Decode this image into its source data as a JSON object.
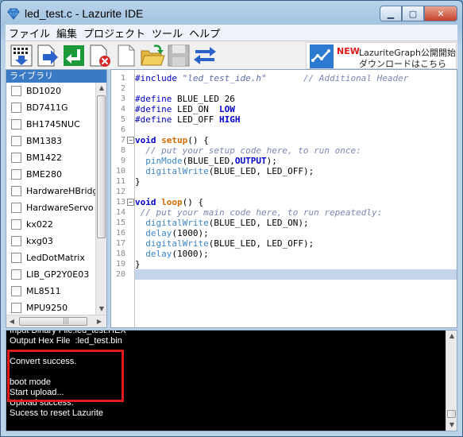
{
  "window": {
    "title": "led_test.c - Lazurite IDE"
  },
  "menu": [
    "ファイル",
    "編集",
    "プロジェクト",
    "ツール",
    "ヘルプ"
  ],
  "toolbar": {
    "buttons": [
      "compile-icon",
      "upload-icon",
      "install-icon",
      "remove-icon",
      "new-file-icon",
      "open-folder-icon",
      "save-icon",
      "serial-monitor-icon"
    ],
    "banner": {
      "new": "NEW",
      "line1": "LazuriteGraph公開開始",
      "line2": "ダウンロードはこちら"
    }
  },
  "library": {
    "header": "ライブラリ",
    "items": [
      "BD1020",
      "BD7411G",
      "BH1745NUC",
      "BM1383",
      "BM1422",
      "BME280",
      "HardwareHBridge",
      "HardwareServo",
      "kx022",
      "kxg03",
      "LedDotMatrix",
      "LIB_GP2Y0E03",
      "ML8511",
      "MPU9250"
    ]
  },
  "editor": {
    "current_line": 20,
    "lines": [
      {
        "n": "1",
        "segs": [
          [
            "pre",
            "#include "
          ],
          [
            "str",
            "\"led_test_ide.h\""
          ],
          [
            "txt",
            "       "
          ],
          [
            "cmt",
            "// Additional Header"
          ]
        ]
      },
      {
        "n": "2",
        "segs": []
      },
      {
        "n": "3",
        "segs": [
          [
            "pre",
            "#define "
          ],
          [
            "txt",
            "BLUE_LED 26"
          ]
        ]
      },
      {
        "n": "4",
        "segs": [
          [
            "pre",
            "#define "
          ],
          [
            "txt",
            "LED_ON  "
          ],
          [
            "kw",
            "LOW"
          ]
        ]
      },
      {
        "n": "5",
        "segs": [
          [
            "pre",
            "#define "
          ],
          [
            "txt",
            "LED_OFF "
          ],
          [
            "kw",
            "HIGH"
          ]
        ]
      },
      {
        "n": "6",
        "segs": []
      },
      {
        "n": "7",
        "fold": true,
        "segs": [
          [
            "kw",
            "void "
          ],
          [
            "fn",
            "setup"
          ],
          [
            "txt",
            "() {"
          ]
        ]
      },
      {
        "n": "8",
        "segs": [
          [
            "txt",
            "  "
          ],
          [
            "cmt",
            "// put your setup code here, to run once:"
          ]
        ]
      },
      {
        "n": "9",
        "segs": [
          [
            "txt",
            "  "
          ],
          [
            "lib",
            "pinMode"
          ],
          [
            "txt",
            "(BLUE_LED,"
          ],
          [
            "kw",
            "OUTPUT"
          ],
          [
            "txt",
            ");"
          ]
        ]
      },
      {
        "n": "10",
        "segs": [
          [
            "txt",
            "  "
          ],
          [
            "lib",
            "digitalWrite"
          ],
          [
            "txt",
            "(BLUE_LED, LED_OFF);"
          ]
        ]
      },
      {
        "n": "11",
        "segs": [
          [
            "txt",
            "}"
          ]
        ]
      },
      {
        "n": "12",
        "segs": []
      },
      {
        "n": "13",
        "fold": true,
        "segs": [
          [
            "kw",
            "void "
          ],
          [
            "fn",
            "loop"
          ],
          [
            "txt",
            "() {"
          ]
        ]
      },
      {
        "n": "14",
        "segs": [
          [
            "txt",
            " "
          ],
          [
            "cmt",
            "// put your main code here, to run repeatedly:"
          ]
        ]
      },
      {
        "n": "15",
        "segs": [
          [
            "txt",
            "  "
          ],
          [
            "lib",
            "digitalWrite"
          ],
          [
            "txt",
            "(BLUE_LED, LED_ON);"
          ]
        ]
      },
      {
        "n": "16",
        "segs": [
          [
            "txt",
            "  "
          ],
          [
            "lib",
            "delay"
          ],
          [
            "txt",
            "(1000);"
          ]
        ]
      },
      {
        "n": "17",
        "segs": [
          [
            "txt",
            "  "
          ],
          [
            "lib",
            "digitalWrite"
          ],
          [
            "txt",
            "(BLUE_LED, LED_OFF);"
          ]
        ]
      },
      {
        "n": "18",
        "segs": [
          [
            "txt",
            "  "
          ],
          [
            "lib",
            "delay"
          ],
          [
            "txt",
            "(1000);"
          ]
        ]
      },
      {
        "n": "19",
        "segs": [
          [
            "txt",
            "}"
          ]
        ]
      },
      {
        "n": "20",
        "segs": []
      }
    ]
  },
  "console": {
    "lines": [
      "Input Binary File:led_test.HEX",
      "Output Hex File  :led_test.bin",
      "",
      "Convert success.",
      "",
      "boot mode",
      "Start upload...",
      "Upload success.",
      "Sucess to reset Lazurite"
    ]
  },
  "colors": {
    "highlight_box": "#e01b1b",
    "library_header": "#3a79c4",
    "current_line": "#c4d4ea"
  }
}
